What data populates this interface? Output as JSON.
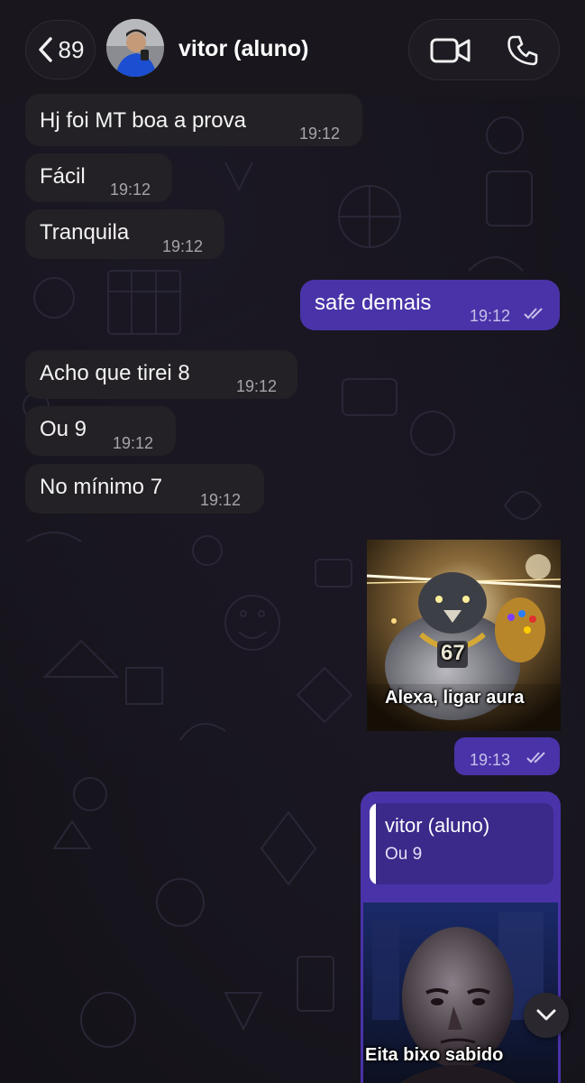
{
  "header": {
    "back_count": "89",
    "contact_name": "vitor (aluno)"
  },
  "messages": [
    {
      "text": "Hj foi MT boa a prova",
      "time": "19:12",
      "direction": "incoming"
    },
    {
      "text": "Fácil",
      "time": "19:12",
      "direction": "incoming"
    },
    {
      "text": "Tranquila",
      "time": "19:12",
      "direction": "incoming"
    },
    {
      "text": "safe demais",
      "time": "19:12",
      "direction": "outgoing",
      "status": "read"
    },
    {
      "text": "Acho que tirei 8",
      "time": "19:12",
      "direction": "incoming"
    },
    {
      "text": "Ou 9",
      "time": "19:12",
      "direction": "incoming"
    },
    {
      "text": "No mínimo 7",
      "time": "19:12",
      "direction": "incoming"
    }
  ],
  "sticker_message": {
    "badge_number": "67",
    "caption": "Alexa, ligar aura",
    "time": "19:13",
    "status": "read"
  },
  "reply_message": {
    "quoted_name": "vitor (aluno)",
    "quoted_text": "Ou 9",
    "image_caption": "Eita bixo sabido"
  },
  "colors": {
    "background": "#141218",
    "incoming_bubble": "#232125",
    "outgoing_bubble": "#4a33a8",
    "accent": "#4a33a8"
  },
  "icons": {
    "back": "chevron-left-icon",
    "video": "video-camera-icon",
    "phone": "phone-icon",
    "scroll_down": "chevron-down-icon",
    "read_ticks": "double-check-icon"
  }
}
